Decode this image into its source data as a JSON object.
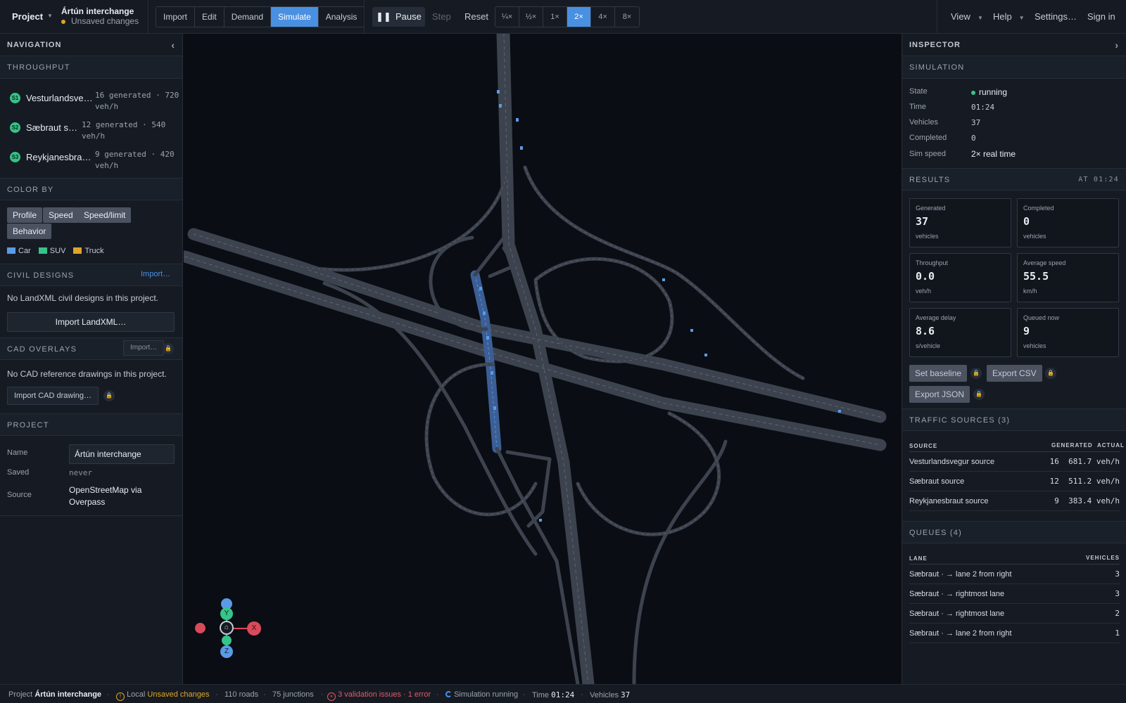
{
  "topbar": {
    "project_label": "Project",
    "project_name": "Ártún interchange",
    "unsaved": "Unsaved changes",
    "tabs": [
      {
        "label": "Import",
        "active": false
      },
      {
        "label": "Edit",
        "active": false
      },
      {
        "label": "Demand",
        "active": false
      },
      {
        "label": "Simulate",
        "active": true
      },
      {
        "label": "Analysis",
        "active": false
      }
    ],
    "pause_label": "Pause",
    "step_label": "Step",
    "reset_label": "Reset",
    "speeds": [
      "¼×",
      "½×",
      "1×",
      "2×",
      "4×",
      "8×"
    ],
    "active_speed": "2×",
    "view_label": "View",
    "help_label": "Help",
    "settings_label": "Settings…",
    "signin_label": "Sign in"
  },
  "nav": {
    "title": "NAVIGATION",
    "throughput": {
      "title": "THROUGHPUT",
      "sources": [
        {
          "badge": "S1",
          "name": "Vesturlandsve…",
          "meta": "16 generated · 720 veh/h"
        },
        {
          "badge": "S2",
          "name": "Sæbraut s…",
          "meta": "12 generated · 540 veh/h"
        },
        {
          "badge": "S3",
          "name": "Reykjanesbra…",
          "meta": "9 generated · 420 veh/h"
        }
      ]
    },
    "color_by": {
      "title": "COLOR BY",
      "options": [
        "Profile",
        "Speed",
        "Speed/limit",
        "Behavior"
      ],
      "legend": [
        {
          "label": "Car",
          "color": "#5a9be6"
        },
        {
          "label": "SUV",
          "color": "#35c489"
        },
        {
          "label": "Truck",
          "color": "#e0a526"
        }
      ]
    },
    "civil": {
      "title": "CIVIL DESIGNS",
      "import_link": "Import…",
      "empty": "No LandXML civil designs in this project.",
      "button": "Import LandXML…"
    },
    "cad": {
      "title": "CAD OVERLAYS",
      "import_button": "Import…",
      "empty": "No CAD reference drawings in this project.",
      "button": "Import CAD drawing…"
    },
    "project": {
      "title": "PROJECT",
      "name_label": "Name",
      "name_value": "Ártún interchange",
      "saved_label": "Saved",
      "saved_value": "never",
      "source_label": "Source",
      "source_value": "OpenStreetMap via Overpass"
    }
  },
  "inspector": {
    "title": "INSPECTOR",
    "simulation": {
      "title": "SIMULATION",
      "state_label": "State",
      "state_value": "running",
      "time_label": "Time",
      "time_value": "01:24",
      "vehicles_label": "Vehicles",
      "vehicles_value": "37",
      "completed_label": "Completed",
      "completed_value": "0",
      "simspeed_label": "Sim speed",
      "simspeed_value": "2× real time"
    },
    "results": {
      "title": "RESULTS",
      "at": "AT 01:24",
      "cards": [
        {
          "label": "Generated",
          "value": "37",
          "unit": "vehicles"
        },
        {
          "label": "Completed",
          "value": "0",
          "unit": "vehicles"
        },
        {
          "label": "Throughput",
          "value": "0.0",
          "unit": "veh/h"
        },
        {
          "label": "Average speed",
          "value": "55.5",
          "unit": "km/h"
        },
        {
          "label": "Average delay",
          "value": "8.6",
          "unit": "s/vehicle"
        },
        {
          "label": "Queued now",
          "value": "9",
          "unit": "vehicles"
        }
      ],
      "set_baseline": "Set baseline",
      "export_csv": "Export CSV",
      "export_json": "Export JSON"
    },
    "traffic_sources": {
      "title": "TRAFFIC SOURCES (3)",
      "col_source": "SOURCE",
      "col_generated": "GENERATED",
      "col_actual": "ACTUAL",
      "rows": [
        {
          "name": "Vesturlandsvegur source",
          "generated": "16",
          "actual": "681.7 veh/h"
        },
        {
          "name": "Sæbraut source",
          "generated": "12",
          "actual": "511.2 veh/h"
        },
        {
          "name": "Reykjanesbraut source",
          "generated": "9",
          "actual": "383.4 veh/h"
        }
      ]
    },
    "queues": {
      "title": "QUEUES (4)",
      "col_lane": "LANE",
      "col_vehicles": "VEHICLES",
      "rows": [
        {
          "lane": "Sæbraut · → lane 2 from right",
          "vehicles": "3"
        },
        {
          "lane": "Sæbraut · → rightmost lane",
          "vehicles": "3"
        },
        {
          "lane": "Sæbraut · → rightmost lane",
          "vehicles": "2"
        },
        {
          "lane": "Sæbraut · → lane 2 from right",
          "vehicles": "1"
        }
      ]
    }
  },
  "map": {
    "axis_x": "X",
    "axis_y": "Y",
    "axis_z": "Z"
  },
  "statusbar": {
    "project_label": "Project",
    "project_name": "Ártún interchange",
    "local": "Local",
    "unsaved": "Unsaved changes",
    "roads": "110 roads",
    "junctions": "75 junctions",
    "validation": "3 validation issues · 1 error",
    "sim_running": "Simulation running",
    "time_label": "Time",
    "time_value": "01:24",
    "vehicles_label": "Vehicles",
    "vehicles_value": "37"
  }
}
